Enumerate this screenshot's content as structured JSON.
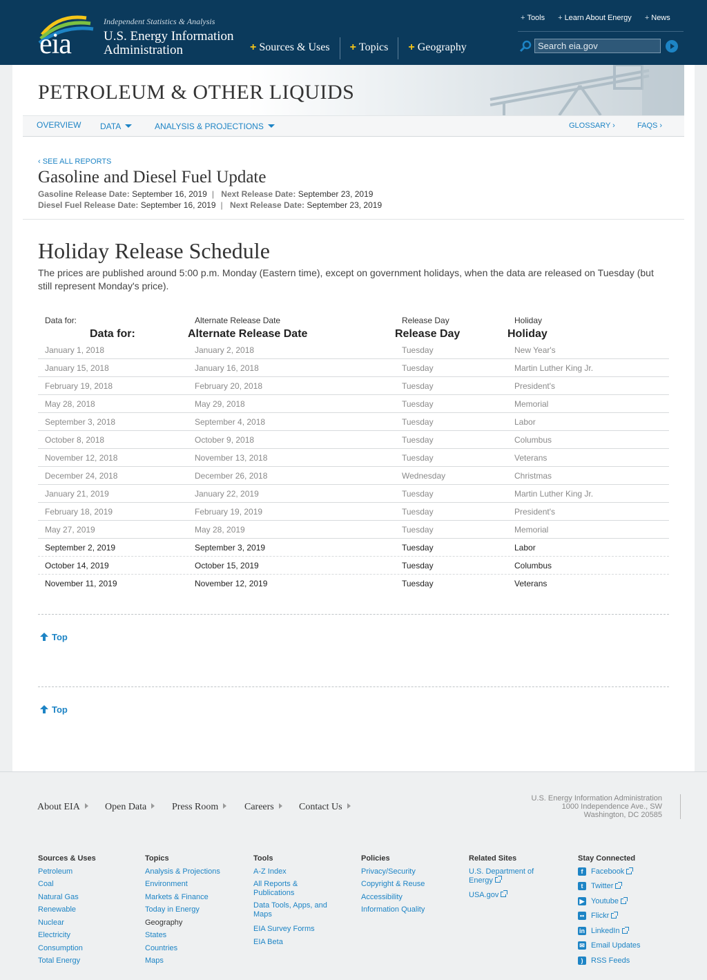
{
  "header": {
    "tagline": "Independent Statistics & Analysis",
    "org_line1": "U.S. Energy Information",
    "org_line2": "Administration",
    "logo_text": "eia",
    "main_nav": [
      "Sources & Uses",
      "Topics",
      "Geography"
    ],
    "util_nav": [
      "Tools",
      "Learn About Energy",
      "News"
    ],
    "search_placeholder": "Search eia.gov"
  },
  "banner": {
    "title": "PETROLEUM & OTHER LIQUIDS"
  },
  "subnav": {
    "overview": "OVERVIEW",
    "data": "DATA",
    "analysis": "ANALYSIS & PROJECTIONS",
    "glossary": "GLOSSARY ›",
    "faqs": "FAQS ›"
  },
  "report": {
    "see_all": "‹ SEE ALL REPORTS",
    "title": "Gasoline and Diesel Fuel Update",
    "gas_label": "Gasoline Release Date:",
    "gas_date": "September 16, 2019",
    "gas_next_label": "Next Release Date:",
    "gas_next": "September 23, 2019",
    "diesel_label": "Diesel Fuel Release Date:",
    "diesel_date": "September 16, 2019",
    "diesel_next_label": "Next Release Date:",
    "diesel_next": "September 23, 2019",
    "separator": "|"
  },
  "schedule": {
    "title": "Holiday Release Schedule",
    "intro": "The prices are published around 5:00 p.m. Monday (Eastern time), except on government holidays, when the data are released on Tuesday (but still represent Monday's price).",
    "headers_small": [
      "Data for:",
      "Alternate Release Date",
      "Release Day",
      "Holiday"
    ],
    "headers_big": [
      "Data for:",
      "Alternate Release Date",
      "Release Day",
      "Holiday"
    ],
    "rows": [
      [
        "January 1, 2018",
        "January 2, 2018",
        "Tuesday",
        "New Year's"
      ],
      [
        "January 15, 2018",
        "January 16, 2018",
        "Tuesday",
        "Martin Luther King Jr."
      ],
      [
        "February 19, 2018",
        "February 20, 2018",
        "Tuesday",
        "President's"
      ],
      [
        "May 28, 2018",
        "May 29, 2018",
        "Tuesday",
        "Memorial"
      ],
      [
        "September 3, 2018",
        "September 4, 2018",
        "Tuesday",
        "Labor"
      ],
      [
        "October 8, 2018",
        "October 9, 2018",
        "Tuesday",
        "Columbus"
      ],
      [
        "November 12, 2018",
        "November 13, 2018",
        "Tuesday",
        "Veterans"
      ],
      [
        "December 24, 2018",
        "December 26, 2018",
        "Wednesday",
        "Christmas"
      ],
      [
        "January 21, 2019",
        "January 22, 2019",
        "Tuesday",
        "Martin Luther King Jr."
      ],
      [
        "February 18, 2019",
        "February 19, 2019",
        "Tuesday",
        "President's"
      ],
      [
        "May 27, 2019",
        "May 28, 2019",
        "Tuesday",
        "Memorial"
      ],
      [
        "September 2, 2019",
        "September 3, 2019",
        "Tuesday",
        "Labor"
      ],
      [
        "October 14, 2019",
        "October 15, 2019",
        "Tuesday",
        "Columbus"
      ],
      [
        "November 11, 2019",
        "November 12, 2019",
        "Tuesday",
        "Veterans"
      ]
    ],
    "top_label": "Top"
  },
  "footer": {
    "nav": [
      "About EIA",
      "Open Data",
      "Press Room",
      "Careers",
      "Contact Us"
    ],
    "address": [
      "U.S. Energy Information Administration",
      "1000 Independence Ave., SW",
      "Washington, DC 20585"
    ],
    "sources_uses": {
      "heading": "Sources & Uses",
      "links": [
        "Petroleum",
        "Coal",
        "Natural Gas",
        "Renewable",
        "Nuclear",
        "Electricity",
        "Consumption",
        "Total Energy"
      ]
    },
    "topics": {
      "heading": "Topics",
      "links": [
        "Analysis & Projections",
        "Environment",
        "Markets & Finance",
        "Today in Energy"
      ],
      "subheading": "Geography",
      "sublinks": [
        "States",
        "Countries",
        "Maps"
      ]
    },
    "tools": {
      "heading": "Tools",
      "links": [
        "A-Z Index",
        "All Reports & Publications",
        "Data Tools, Apps, and Maps",
        "EIA Survey Forms",
        "EIA Beta"
      ]
    },
    "policies": {
      "heading": "Policies",
      "links": [
        "Privacy/Security",
        "Copyright & Reuse",
        "Accessibility",
        "Information Quality"
      ]
    },
    "related": {
      "heading": "Related Sites",
      "links": [
        "U.S. Department of Energy",
        "USA.gov"
      ]
    },
    "connected": {
      "heading": "Stay Connected",
      "links": [
        "Facebook",
        "Twitter",
        "Youtube",
        "Flickr",
        "LinkedIn",
        "Email Updates",
        "RSS Feeds"
      ]
    }
  },
  "colors": {
    "header_bg": "#0b3a5c",
    "link": "#1d84c5",
    "accent_plus": "#f5c518"
  }
}
